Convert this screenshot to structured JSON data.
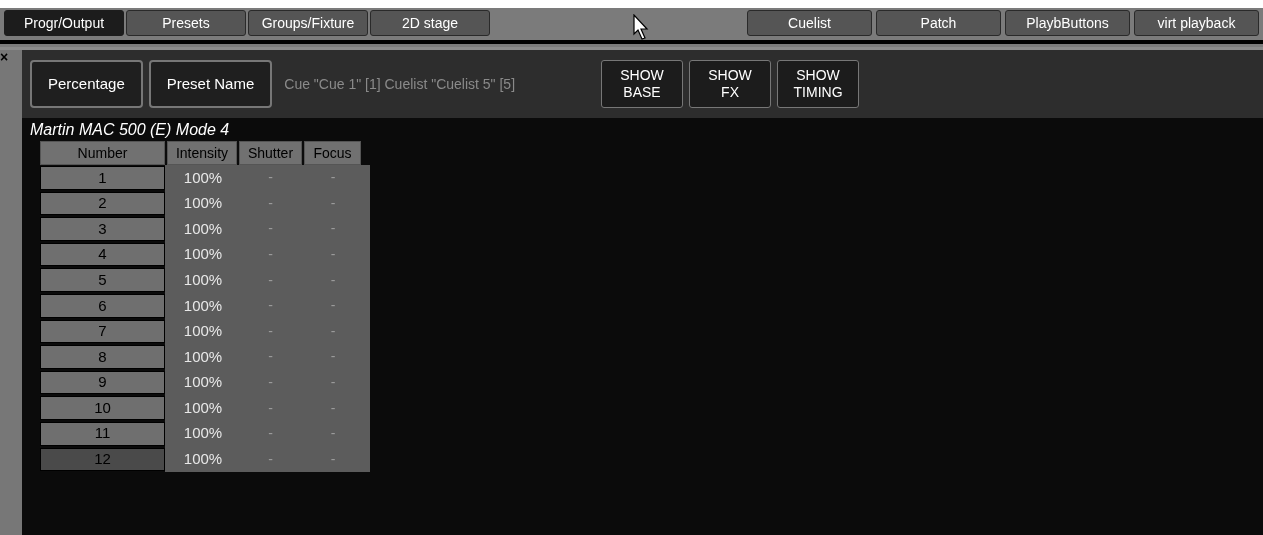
{
  "tabs_left": [
    {
      "label": "Progr/Output",
      "selected": true
    },
    {
      "label": "Presets",
      "selected": false
    },
    {
      "label": "Groups/Fixture",
      "selected": false
    },
    {
      "label": "2D stage",
      "selected": false
    }
  ],
  "tabs_right": [
    {
      "label": "Cuelist",
      "selected": false
    },
    {
      "label": "Patch",
      "selected": false
    },
    {
      "label": "PlaybButtons",
      "selected": false
    },
    {
      "label": "virt playback",
      "selected": false
    }
  ],
  "close": "×",
  "toolbar": {
    "buttons": [
      "Percentage",
      "Preset Name"
    ],
    "cue_info": "Cue \"Cue 1\" [1] Cuelist \"Cuelist 5\" [5]",
    "show_buttons": [
      [
        "SHOW",
        "BASE"
      ],
      [
        "SHOW",
        "FX"
      ],
      [
        "SHOW",
        "TIMING"
      ]
    ]
  },
  "fixture_title": "Martin MAC 500 (E) Mode 4",
  "table": {
    "columns": [
      "Number",
      "Intensity",
      "Shutter",
      "Focus"
    ],
    "rows": [
      {
        "number": "1",
        "intensity": "100%",
        "shutter": "-",
        "focus": "-",
        "selected": false
      },
      {
        "number": "2",
        "intensity": "100%",
        "shutter": "-",
        "focus": "-",
        "selected": false
      },
      {
        "number": "3",
        "intensity": "100%",
        "shutter": "-",
        "focus": "-",
        "selected": false
      },
      {
        "number": "4",
        "intensity": "100%",
        "shutter": "-",
        "focus": "-",
        "selected": false
      },
      {
        "number": "5",
        "intensity": "100%",
        "shutter": "-",
        "focus": "-",
        "selected": false
      },
      {
        "number": "6",
        "intensity": "100%",
        "shutter": "-",
        "focus": "-",
        "selected": false
      },
      {
        "number": "7",
        "intensity": "100%",
        "shutter": "-",
        "focus": "-",
        "selected": false
      },
      {
        "number": "8",
        "intensity": "100%",
        "shutter": "-",
        "focus": "-",
        "selected": false
      },
      {
        "number": "9",
        "intensity": "100%",
        "shutter": "-",
        "focus": "-",
        "selected": false
      },
      {
        "number": "10",
        "intensity": "100%",
        "shutter": "-",
        "focus": "-",
        "selected": false
      },
      {
        "number": "11",
        "intensity": "100%",
        "shutter": "-",
        "focus": "-",
        "selected": false
      },
      {
        "number": "12",
        "intensity": "100%",
        "shutter": "-",
        "focus": "-",
        "selected": true
      }
    ]
  }
}
